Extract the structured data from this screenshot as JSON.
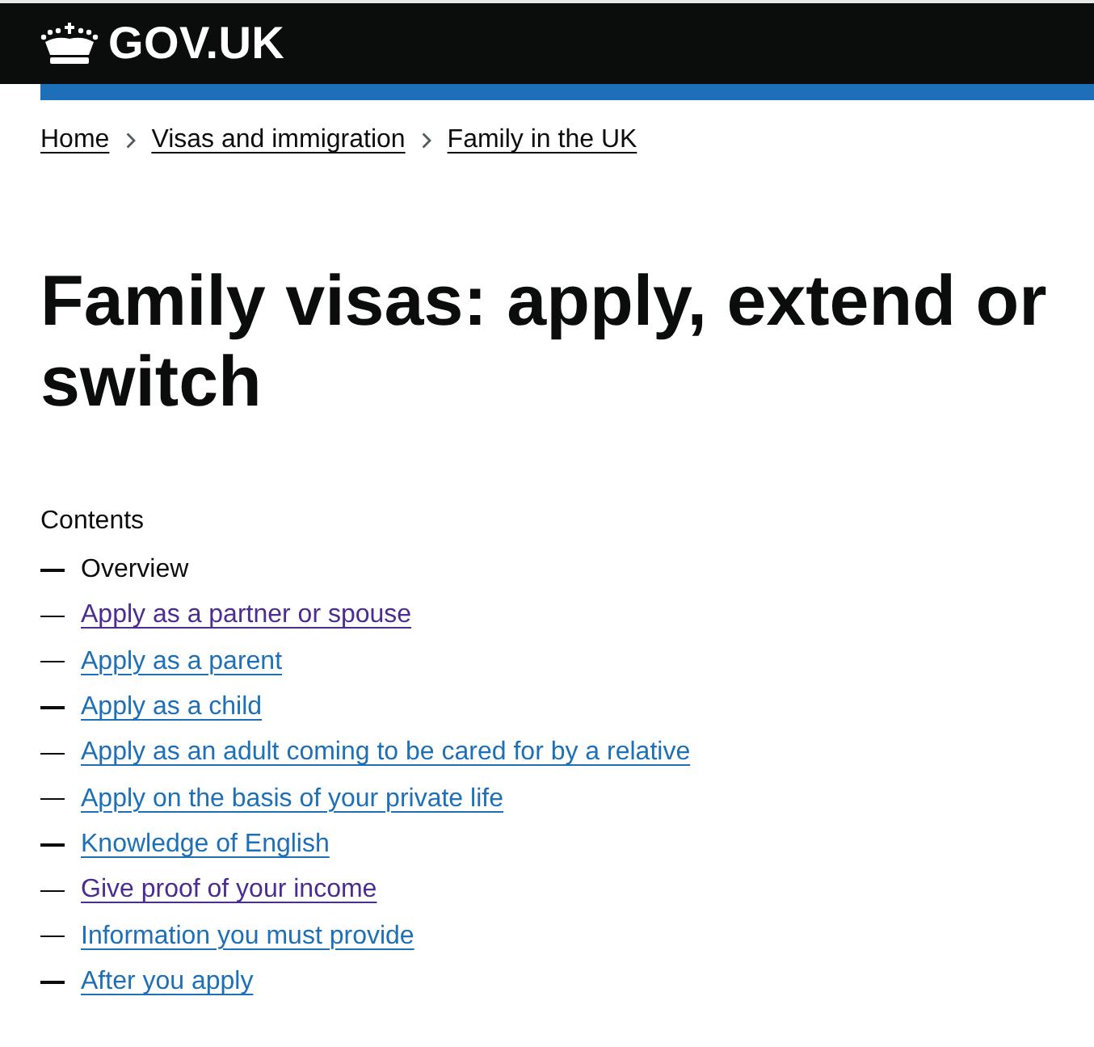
{
  "header": {
    "logo_text": "GOV.UK"
  },
  "breadcrumbs": [
    {
      "label": "Home"
    },
    {
      "label": "Visas and immigration"
    },
    {
      "label": "Family in the UK"
    }
  ],
  "title": "Family visas: apply, extend or switch",
  "contents": {
    "heading": "Contents",
    "items": [
      {
        "label": "Overview",
        "selected": true
      },
      {
        "label": "Apply as a partner or spouse",
        "selected": false,
        "visited": true
      },
      {
        "label": "Apply as a parent",
        "selected": false,
        "visited": false
      },
      {
        "label": "Apply as a child",
        "selected": false,
        "visited": false
      },
      {
        "label": "Apply as an adult coming to be cared for by a relative",
        "selected": false,
        "visited": false
      },
      {
        "label": "Apply on the basis of your private life",
        "selected": false,
        "visited": false
      },
      {
        "label": "Knowledge of English",
        "selected": false,
        "visited": false
      },
      {
        "label": "Give proof of your income",
        "selected": false,
        "visited": true
      },
      {
        "label": "Information you must provide",
        "selected": false,
        "visited": false
      },
      {
        "label": "After you apply",
        "selected": false,
        "visited": false
      }
    ]
  }
}
